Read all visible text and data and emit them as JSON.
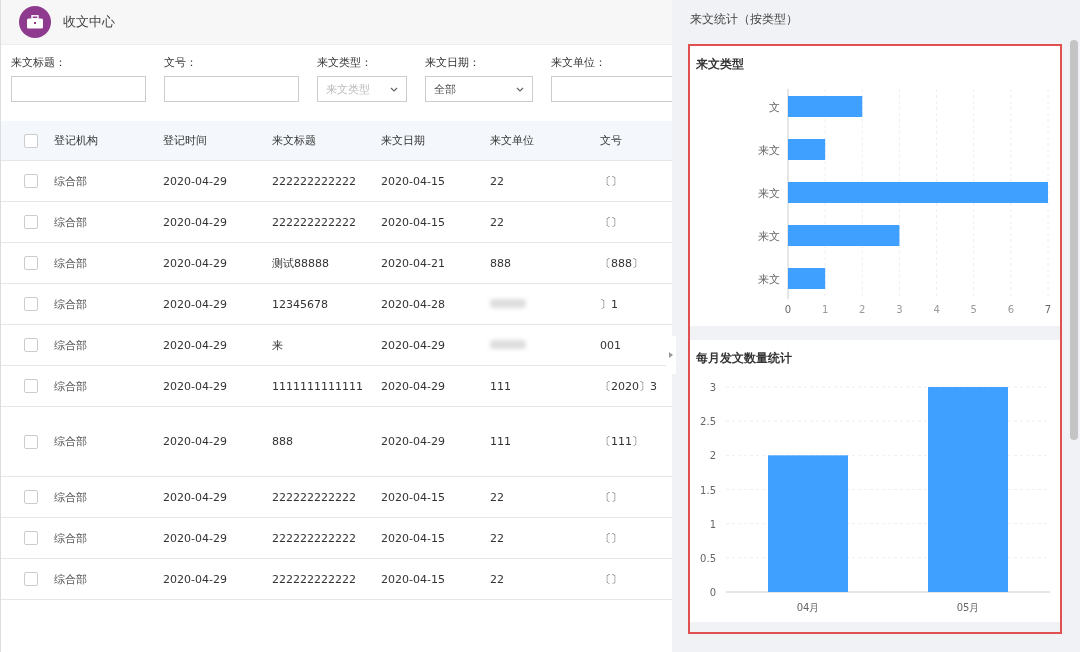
{
  "header": {
    "title": "收文中心"
  },
  "filters": [
    {
      "kind": "text",
      "label": "来文标题："
    },
    {
      "kind": "text",
      "label": "文号："
    },
    {
      "kind": "select",
      "label": "来文类型：",
      "placeholder": "来文类型"
    },
    {
      "kind": "select",
      "label": "来文日期：",
      "value": "全部"
    },
    {
      "kind": "text",
      "label": "来文单位："
    }
  ],
  "table": {
    "columns": [
      "登记机构",
      "登记时间",
      "来文标题",
      "来文日期",
      "来文单位",
      "文号"
    ],
    "header_checkbox": {
      "checked": false
    },
    "rows": [
      {
        "checked": false,
        "cells": [
          "综合部",
          "2020-04-29",
          "222222222222",
          "2020-04-15",
          "22",
          "〔〕"
        ]
      },
      {
        "checked": false,
        "cells": [
          "综合部",
          "2020-04-29",
          "222222222222",
          "2020-04-15",
          "22",
          "〔〕"
        ]
      },
      {
        "checked": false,
        "cells": [
          "综合部",
          "2020-04-29",
          "测试88888",
          "2020-04-21",
          "888",
          "〔888〕"
        ]
      },
      {
        "checked": false,
        "cells": [
          "综合部",
          "2020-04-29",
          "12345678",
          "2020-04-28",
          null,
          "〕1"
        ]
      },
      {
        "checked": false,
        "cells": [
          "综合部",
          "2020-04-29",
          "来",
          "2020-04-29",
          null,
          "001"
        ]
      },
      {
        "checked": false,
        "cells": [
          "综合部",
          "2020-04-29",
          "1111111111111",
          "2020-04-29",
          "111",
          "〔2020〕3"
        ]
      },
      {
        "checked": false,
        "tall": true,
        "cells": [
          "综合部",
          "2020-04-29",
          "888",
          "2020-04-29",
          "111",
          "〔111〕"
        ]
      },
      {
        "checked": false,
        "cells": [
          "综合部",
          "2020-04-29",
          "222222222222",
          "2020-04-15",
          "22",
          "〔〕"
        ]
      },
      {
        "checked": false,
        "cells": [
          "综合部",
          "2020-04-29",
          "222222222222",
          "2020-04-15",
          "22",
          "〔〕"
        ]
      },
      {
        "checked": false,
        "cells": [
          "综合部",
          "2020-04-29",
          "222222222222",
          "2020-04-15",
          "22",
          "〔〕"
        ]
      }
    ]
  },
  "stats_panel": {
    "title": "来文统计（按类型）",
    "cards": [
      {
        "title": "来文类型",
        "chart_data": {
          "type": "bar",
          "orientation": "horizontal",
          "categories": [
            "文",
            "来文",
            "来文",
            "来文",
            "来文"
          ],
          "series": [
            {
              "color": "#3fa0ff",
              "values": [
                2,
                1,
                7,
                3,
                1
              ]
            }
          ],
          "grid": true,
          "xlim": [
            0,
            7
          ],
          "xticks": [
            0,
            1,
            2,
            3,
            4,
            5,
            6,
            7
          ]
        }
      },
      {
        "title": "每月发文数量统计",
        "chart_data": {
          "type": "bar",
          "orientation": "vertical",
          "categories": [
            "04月",
            "05月"
          ],
          "series": [
            {
              "color": "#3fa0ff",
              "values": [
                2,
                3
              ]
            }
          ],
          "grid": true,
          "ylim": [
            0,
            3
          ],
          "yticks": [
            0,
            0.5,
            1,
            1.5,
            2,
            2.5,
            3
          ]
        }
      }
    ]
  }
}
